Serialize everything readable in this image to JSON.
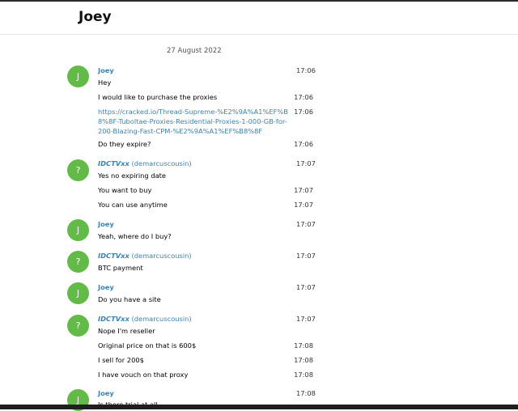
{
  "header": {
    "title": "Joey"
  },
  "date_label": "27 August 2022",
  "avatar_letters": {
    "joey": "J",
    "other": "?"
  },
  "senders": {
    "joey": {
      "name": "Joey"
    },
    "other": {
      "name_italic": "IDCTVxx",
      "name_rest": " (demarcuscousin)"
    }
  },
  "messages": [
    {
      "text": "Hey",
      "time": "17:06"
    },
    {
      "text": "I would like to purchase the proxies",
      "time": "17:06"
    },
    {
      "text": "https://cracked.io/Thread-Supreme-%E2%9A%A1%EF%B8%8F-Tuboltae-Proxies-Residential-Proxies-1-000-GB-for-200-Blazing-Fast-CPM-%E2%9A%A1%EF%B8%8F",
      "time": "17:06"
    },
    {
      "text": "Do they expire?",
      "time": "17:06"
    },
    {
      "text": "Yes no expiring date",
      "time": "17:07"
    },
    {
      "text": "You want to buy",
      "time": "17:07"
    },
    {
      "text": "You can use anytime",
      "time": "17:07"
    },
    {
      "text": "Yeah, where do I buy?",
      "time": "17:07"
    },
    {
      "text": "BTC payment",
      "time": "17:07"
    },
    {
      "text": "Do you have a site",
      "time": "17:07"
    },
    {
      "text": "Nope I'm reseller",
      "time": "17:07"
    },
    {
      "text": "Original price on that is 600$",
      "time": "17:08"
    },
    {
      "text": "I sell for 200$",
      "time": "17:08"
    },
    {
      "text": "I have vouch on that proxy",
      "time": "17:08"
    },
    {
      "text": "Is there trial at all",
      "time": "17:08"
    }
  ]
}
